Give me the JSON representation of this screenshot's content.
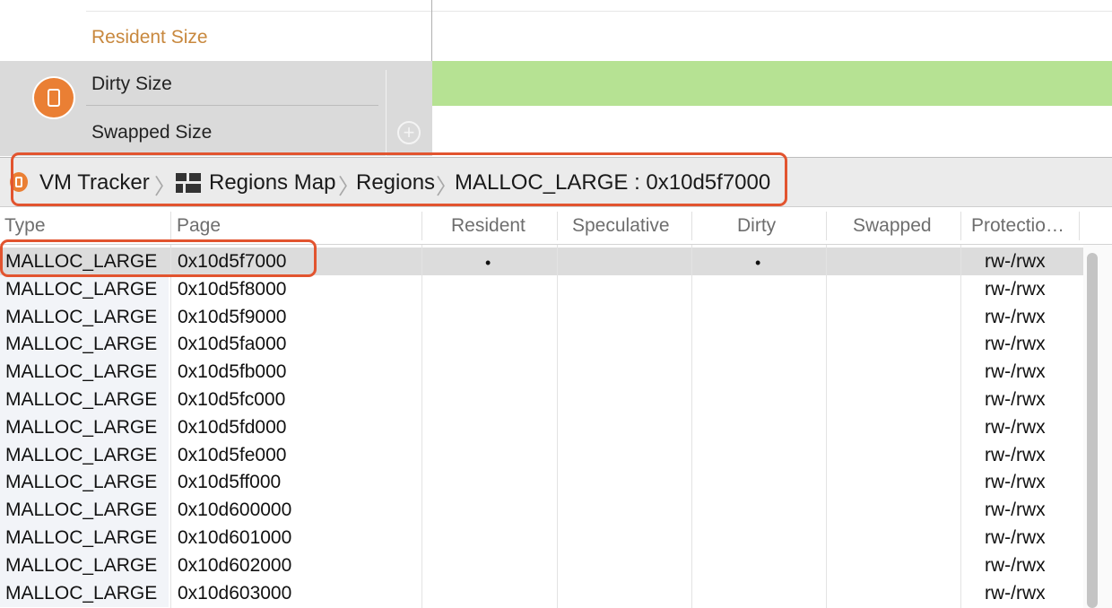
{
  "instrument": {
    "resident_label": "Resident Size",
    "dirty_label": "Dirty Size",
    "swapped_label": "Swapped Size",
    "add_icon": "plus-circle-icon",
    "track_icon": "vm-tracker-icon",
    "colors": {
      "resident": "#c8883e",
      "track_fill": "#b6e293",
      "accent": "#ea7f34",
      "highlight": "#e2542f"
    }
  },
  "breadcrumb": {
    "items": [
      {
        "label": "VM Tracker",
        "icon": "vm-tracker-icon"
      },
      {
        "label": "Regions Map",
        "icon": "regions-map-icon"
      },
      {
        "label": "Regions"
      },
      {
        "label": "MALLOC_LARGE : 0x10d5f7000"
      }
    ],
    "separator": "〉"
  },
  "table": {
    "columns": [
      "Type",
      "Page",
      "Resident",
      "Speculative",
      "Dirty",
      "Swapped",
      "Protectio…"
    ],
    "rows": [
      {
        "type": "MALLOC_LARGE",
        "page": "0x10d5f7000",
        "resident": "•",
        "speculative": "",
        "dirty": "•",
        "swapped": "",
        "protection": "rw-/rwx",
        "selected": true
      },
      {
        "type": "MALLOC_LARGE",
        "page": "0x10d5f8000",
        "resident": "",
        "speculative": "",
        "dirty": "",
        "swapped": "",
        "protection": "rw-/rwx"
      },
      {
        "type": "MALLOC_LARGE",
        "page": "0x10d5f9000",
        "resident": "",
        "speculative": "",
        "dirty": "",
        "swapped": "",
        "protection": "rw-/rwx"
      },
      {
        "type": "MALLOC_LARGE",
        "page": "0x10d5fa000",
        "resident": "",
        "speculative": "",
        "dirty": "",
        "swapped": "",
        "protection": "rw-/rwx"
      },
      {
        "type": "MALLOC_LARGE",
        "page": "0x10d5fb000",
        "resident": "",
        "speculative": "",
        "dirty": "",
        "swapped": "",
        "protection": "rw-/rwx"
      },
      {
        "type": "MALLOC_LARGE",
        "page": "0x10d5fc000",
        "resident": "",
        "speculative": "",
        "dirty": "",
        "swapped": "",
        "protection": "rw-/rwx"
      },
      {
        "type": "MALLOC_LARGE",
        "page": "0x10d5fd000",
        "resident": "",
        "speculative": "",
        "dirty": "",
        "swapped": "",
        "protection": "rw-/rwx"
      },
      {
        "type": "MALLOC_LARGE",
        "page": "0x10d5fe000",
        "resident": "",
        "speculative": "",
        "dirty": "",
        "swapped": "",
        "protection": "rw-/rwx"
      },
      {
        "type": "MALLOC_LARGE",
        "page": "0x10d5ff000",
        "resident": "",
        "speculative": "",
        "dirty": "",
        "swapped": "",
        "protection": "rw-/rwx"
      },
      {
        "type": "MALLOC_LARGE",
        "page": "0x10d600000",
        "resident": "",
        "speculative": "",
        "dirty": "",
        "swapped": "",
        "protection": "rw-/rwx"
      },
      {
        "type": "MALLOC_LARGE",
        "page": "0x10d601000",
        "resident": "",
        "speculative": "",
        "dirty": "",
        "swapped": "",
        "protection": "rw-/rwx"
      },
      {
        "type": "MALLOC_LARGE",
        "page": "0x10d602000",
        "resident": "",
        "speculative": "",
        "dirty": "",
        "swapped": "",
        "protection": "rw-/rwx"
      },
      {
        "type": "MALLOC_LARGE",
        "page": "0x10d603000",
        "resident": "",
        "speculative": "",
        "dirty": "",
        "swapped": "",
        "protection": "rw-/rwx"
      }
    ]
  }
}
